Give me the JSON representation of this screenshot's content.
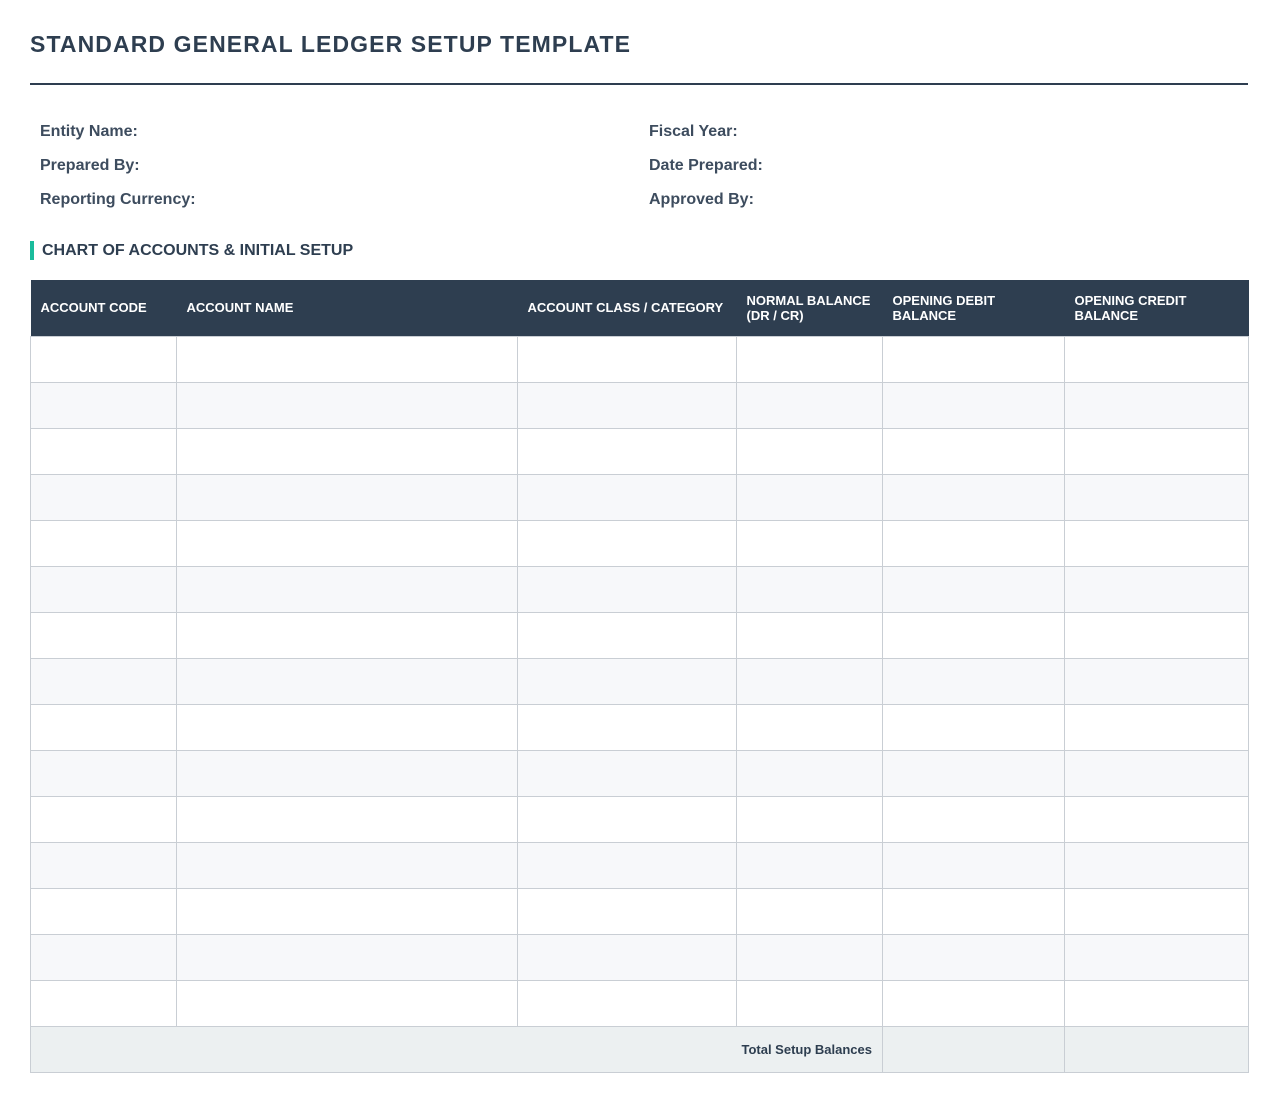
{
  "document": {
    "title": "STANDARD GENERAL LEDGER SETUP TEMPLATE"
  },
  "info_fields": {
    "left": [
      "Entity Name:",
      "Prepared By:",
      "Reporting Currency:"
    ],
    "right": [
      "Fiscal Year:",
      "Date Prepared:",
      "Approved By:"
    ]
  },
  "section": {
    "heading": "CHART OF ACCOUNTS & INITIAL SETUP"
  },
  "table": {
    "headers": [
      "ACCOUNT CODE",
      "ACCOUNT NAME",
      "ACCOUNT CLASS / CATEGORY",
      "NORMAL BALANCE (DR / CR)",
      "OPENING DEBIT BALANCE",
      "OPENING CREDIT BALANCE"
    ],
    "row_count": 15,
    "total_label": "Total Setup Balances"
  },
  "colors": {
    "header_bg": "#2e3e50",
    "accent": "#1abc9c",
    "footer_bg": "#ecf0f1",
    "stripe_bg": "#f7f8fa"
  }
}
